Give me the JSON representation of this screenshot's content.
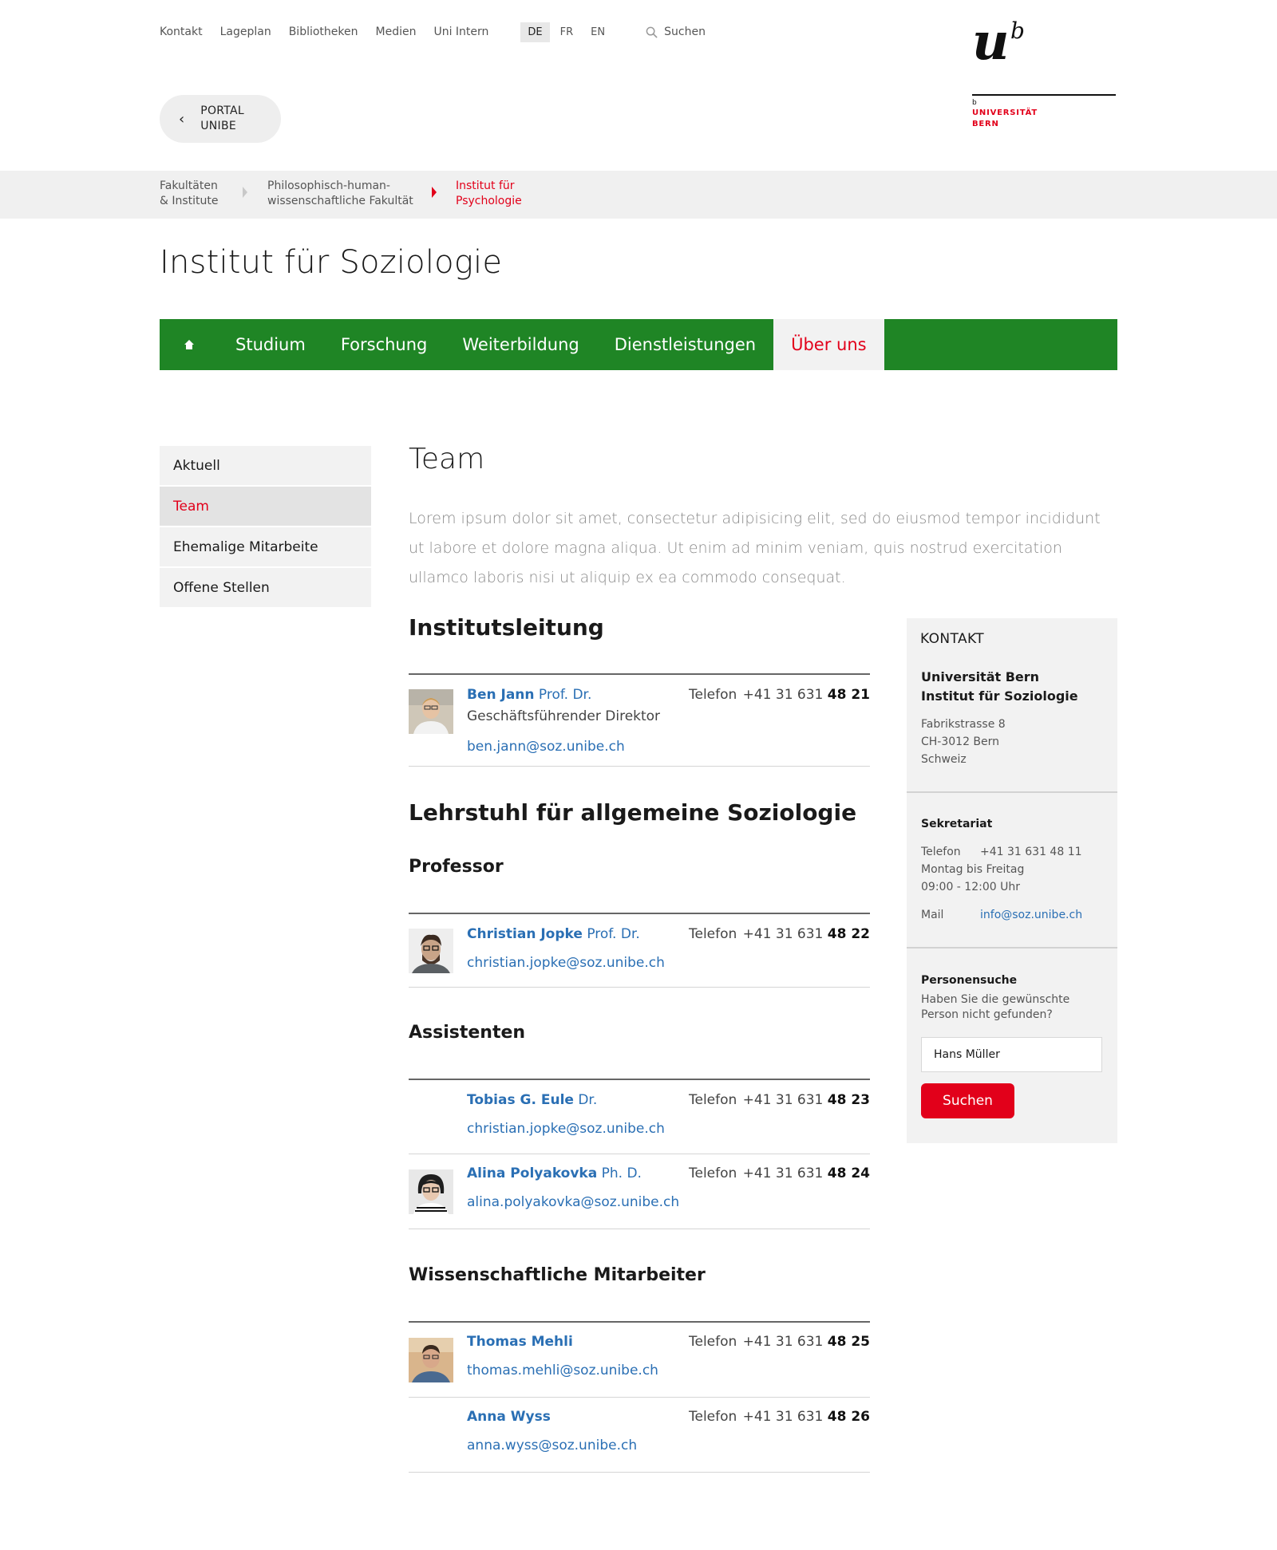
{
  "topnav": {
    "links": [
      "Kontakt",
      "Lageplan",
      "Bibliotheken",
      "Medien",
      "Uni Intern"
    ],
    "languages": [
      "DE",
      "FR",
      "EN"
    ],
    "active_language": "DE",
    "search_label": "Suchen"
  },
  "logo": {
    "mark_u": "u",
    "mark_b": "b",
    "small_b": "b",
    "line1": "UNIVERSITÄT",
    "line2": "BERN"
  },
  "portal": {
    "line1": "PORTAL",
    "line2": "UNIBE"
  },
  "breadcrumb": [
    {
      "line1": "Fakultäten",
      "line2": "& Institute"
    },
    {
      "line1": "Philosophisch-human-",
      "line2": "wissenschaftliche Fakultät"
    },
    {
      "line1": "Institut für",
      "line2": "Psychologie"
    }
  ],
  "page_title": "Institut für Soziologie",
  "mainnav": {
    "items": [
      "Studium",
      "Forschung",
      "Weiterbildung",
      "Dienstleistungen",
      "Über uns"
    ],
    "active": "Über uns"
  },
  "sidenav": {
    "items": [
      "Aktuell",
      "Team",
      "Ehemalige Mitarbeite",
      "Offene Stellen"
    ],
    "active": "Team"
  },
  "content": {
    "heading": "Team",
    "intro": "Lorem ipsum dolor sit amet, consectetur adipisicing elit, sed do eiusmod tempor incididunt ut labore et dolore magna aliqua. Ut enim ad minim veniam, quis nostrud exercitation ullamco laboris nisi ut aliquip ex ea commodo consequat.",
    "sections": {
      "leitung": "Institutsleitung",
      "lehrstuhl": "Lehrstuhl für allgemeine Soziologie",
      "professor": "Professor",
      "assistenten": "Assistenten",
      "mitarbeiter": "Wissenschaftliche Mitarbeiter"
    },
    "tel_label": "Telefon",
    "tel_prefix": "+41 31 631",
    "people": [
      {
        "name": "Ben Jann",
        "title": "Prof. Dr.",
        "role": "Geschäftsführender Direktor",
        "email": "ben.jann@soz.unibe.ch",
        "ext": "48 21"
      },
      {
        "name": "Christian Jopke",
        "title": "Prof. Dr.",
        "email": "christian.jopke@soz.unibe.ch",
        "ext": "48 22"
      },
      {
        "name": "Tobias G. Eule",
        "title": "Dr.",
        "email": "christian.jopke@soz.unibe.ch",
        "ext": "48 23"
      },
      {
        "name": "Alina Polyakovka",
        "title": "Ph. D.",
        "email": "alina.polyakovka@soz.unibe.ch",
        "ext": "48 24"
      },
      {
        "name": "Thomas Mehli",
        "title": "",
        "email": "thomas.mehli@soz.unibe.ch",
        "ext": "48 25"
      },
      {
        "name": "Anna Wyss",
        "title": "",
        "email": "anna.wyss@soz.unibe.ch",
        "ext": "48 26"
      }
    ]
  },
  "kontakt": {
    "title": "KONTAKT",
    "name_line1": "Universität Bern",
    "name_line2": "Institut für Soziologie",
    "addr_line1": "Fabrikstrasse 8",
    "addr_line2": "CH-3012 Bern",
    "addr_line3": "Schweiz",
    "sekretariat_title": "Sekretariat",
    "tel_label": "Telefon",
    "tel_value": "+41 31 631 48 11",
    "hours_line1": "Montag bis Freitag",
    "hours_line2": "09:00 - 12:00 Uhr",
    "mail_label": "Mail",
    "mail_value": "info@soz.unibe.ch",
    "search_title": "Personensuche",
    "search_text_line1": "Haben Sie die gewünschte",
    "search_text_line2": "Person nicht gefunden?",
    "search_value": "Hans Müller",
    "search_button": "Suchen"
  },
  "colors": {
    "green": "#1f8525",
    "red": "#e2001a",
    "link_blue": "#2a6fb4"
  }
}
